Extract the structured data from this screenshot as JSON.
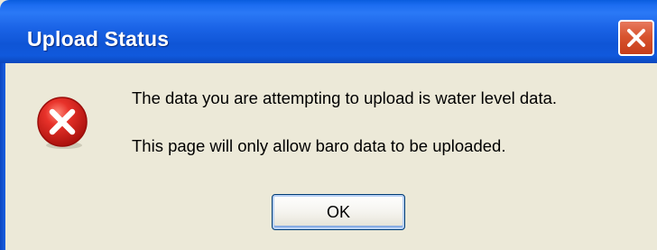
{
  "dialog": {
    "title": "Upload Status",
    "icons": {
      "close": "close-icon",
      "status": "error-icon"
    },
    "messages": [
      "The data you are attempting to upload is water level data.",
      "This page will only allow baro data to be uploaded."
    ],
    "ok_label": "OK"
  },
  "colors": {
    "titlebar": "#1a63e6",
    "close_button": "#d8542f",
    "dialog_background": "#ece9d8",
    "error_icon": "#d11c1c"
  }
}
